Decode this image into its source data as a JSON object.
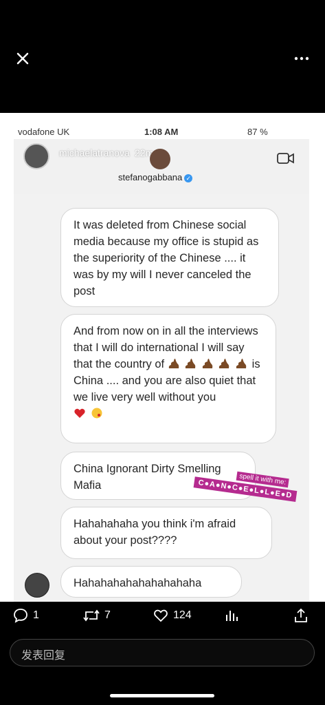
{
  "phone_status": {
    "carrier": "vodafone UK",
    "time": "1:08 AM",
    "battery": "87 %"
  },
  "story": {
    "username": "michaelatranova",
    "time_ago": "22m"
  },
  "dm": {
    "name": "stefanogabbana"
  },
  "messages": [
    "It was deleted from Chinese social media because my office is stupid as the superiority of the Chinese .... it was by my will I never canceled the post",
    "China Ignorant Dirty Smelling Mafia",
    "Hahahahaha you think i'm afraid about your post????",
    "Hahahahahahahahahaha"
  ],
  "message2": {
    "part1": "And from now on in all the interviews that I will do international I will say that the country of",
    "part2": "is China .... and you are also quiet that we live very well without you"
  },
  "sticker": {
    "top": "spell it with me:",
    "main": "C●A●N●C●E●L●L●E●D"
  },
  "footer": {
    "comments": "1",
    "retweets": "7",
    "likes": "124",
    "reply_placeholder": "发表回复"
  },
  "icons": [
    "close-icon",
    "more-icon",
    "comment-icon",
    "retweet-icon",
    "like-icon",
    "stats-icon",
    "share-icon"
  ],
  "colors": {
    "verified": "#3897f0",
    "sticker": "#b52b8f"
  }
}
